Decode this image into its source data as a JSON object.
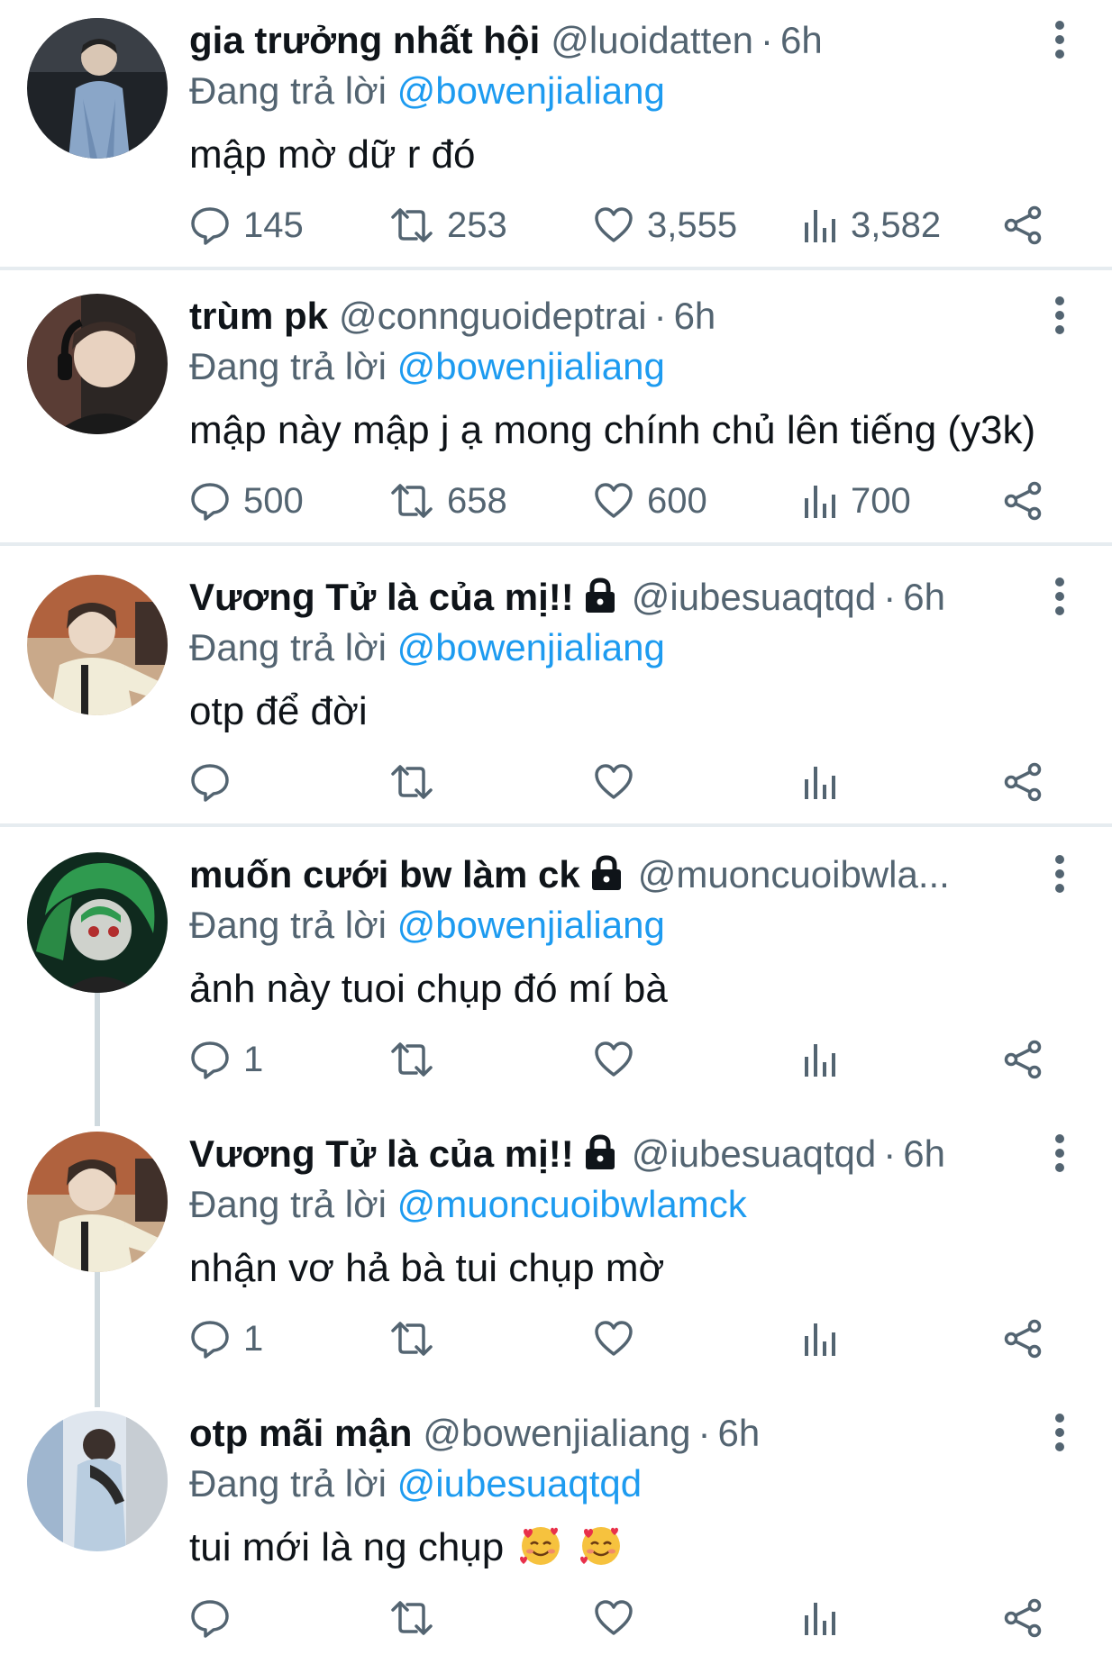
{
  "colors": {
    "text": "#0f1419",
    "secondary": "#536471",
    "link": "#1d9bf0",
    "divider": "#e6ecf0",
    "thread_line": "#cfd9de"
  },
  "tweets": [
    {
      "name": "gia trưởng nhất hội",
      "handle": "@luoidatten",
      "separator": "·",
      "time": "6h",
      "replying_label": "Đang trả lời",
      "replying_to": "@bowenjialiang",
      "text": "mập mờ dữ r đó",
      "replies": "145",
      "retweets": "253",
      "likes": "3,555",
      "views": "3,582",
      "locked": false
    },
    {
      "name": "trùm pk",
      "handle": "@connguoideptrai",
      "separator": "·",
      "time": "6h",
      "replying_label": "Đang trả lời",
      "replying_to": "@bowenjialiang",
      "text": "mập này mập j ạ mong chính chủ lên tiếng (y3k)",
      "replies": "500",
      "retweets": "658",
      "likes": "600",
      "views": "700",
      "locked": false
    },
    {
      "name": "Vương Tử là của mị!!",
      "handle": "@iubesuaqtqd",
      "separator": "·",
      "time": "6h",
      "replying_label": "Đang trả lời",
      "replying_to": "@bowenjialiang",
      "text": "otp để đời",
      "replies": "",
      "retweets": "",
      "likes": "",
      "views": "",
      "locked": true
    },
    {
      "name": "muốn cưới bw làm ck",
      "handle": "@muoncuoibwla...",
      "separator": "",
      "time": "",
      "replying_label": "Đang trả lời",
      "replying_to": "@bowenjialiang",
      "text": "ảnh này tuoi chụp đó mí bà",
      "replies": "1",
      "retweets": "",
      "likes": "",
      "views": "",
      "locked": true
    },
    {
      "name": "Vương Tử là của mị!!",
      "handle": "@iubesuaqtqd",
      "separator": "·",
      "time": "6h",
      "replying_label": "Đang trả lời",
      "replying_to": "@muoncuoibwlamck",
      "text": "nhận vơ hả bà tui chụp mờ",
      "replies": "1",
      "retweets": "",
      "likes": "",
      "views": "",
      "locked": true
    },
    {
      "name": "otp mãi mận",
      "handle": "@bowenjialiang",
      "separator": "·",
      "time": "6h",
      "replying_label": "Đang trả lời",
      "replying_to": "@iubesuaqtqd",
      "text": "tui mới là ng chụp",
      "emoji": [
        "smiling-face-with-hearts-emoji",
        "smiling-face-with-hearts-emoji"
      ],
      "replies": "",
      "retweets": "",
      "likes": "",
      "views": "",
      "locked": false
    }
  ]
}
